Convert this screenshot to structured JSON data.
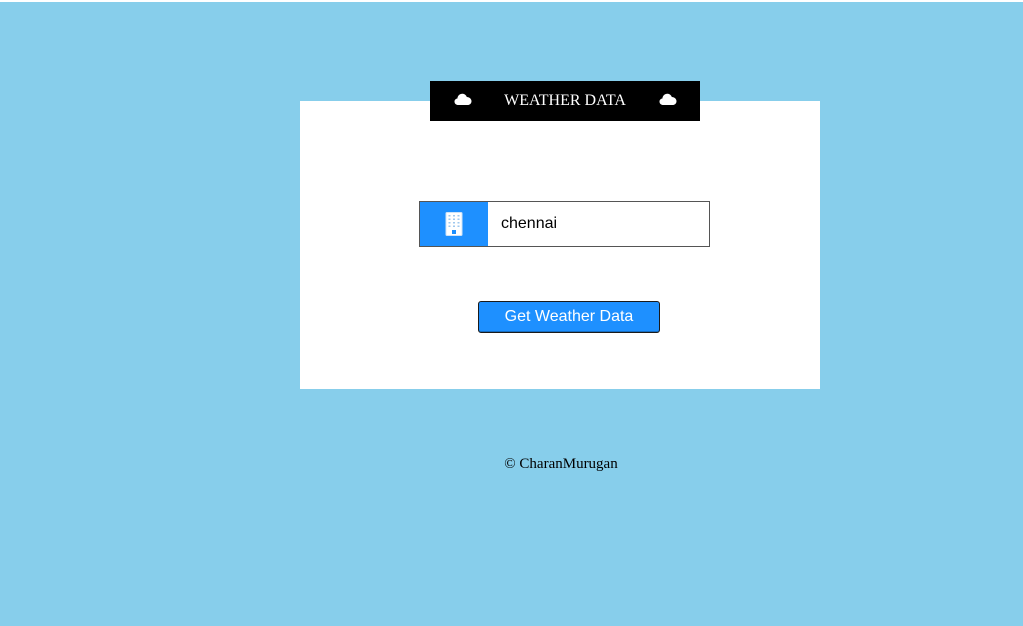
{
  "header": {
    "title": "WEATHER DATA",
    "left_icon": "cloud-icon",
    "right_icon": "cloud-icon"
  },
  "form": {
    "city_icon": "building-icon",
    "city_value": "chennai",
    "submit_label": "Get Weather Data"
  },
  "footer": {
    "text": "© CharanMurugan"
  },
  "colors": {
    "background": "#87ceeb",
    "card": "#ffffff",
    "header": "#000000",
    "accent": "#1e90ff"
  }
}
